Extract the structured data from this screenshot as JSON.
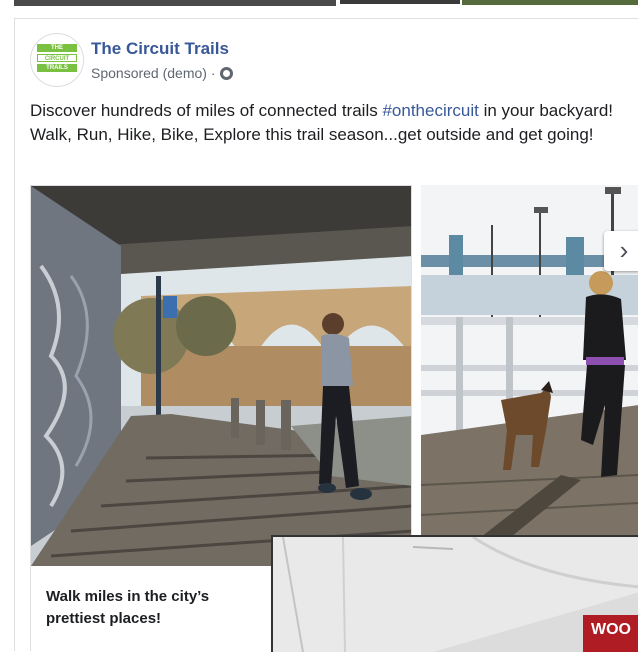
{
  "page": {
    "name": "The Circuit Trails",
    "sponsored_label": "Sponsored (demo) ·",
    "logo_lines": [
      "THE",
      "CIRCUIT",
      "TRAILS"
    ]
  },
  "post": {
    "text_before": "Discover hundreds of miles of connected trails ",
    "hashtag": "#onthecircuit",
    "text_after": " in your backyard! Walk, Run, Hike, Bike, Explore this trail season...get outside and get going!"
  },
  "carousel": {
    "slides": [
      {
        "caption": "Walk miles in the city’s prettiest places!"
      },
      {
        "caption": ""
      }
    ],
    "next_glyph": "›"
  },
  "overlay": {
    "partial_text": "WOO"
  },
  "colors": {
    "brand_link": "#385898",
    "logo_green": "#7ac142"
  }
}
